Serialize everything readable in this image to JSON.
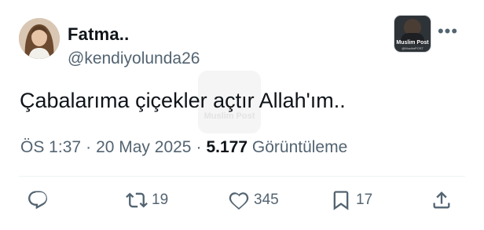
{
  "author": {
    "display_name": "Fatma..",
    "handle": "@kendiyolunda26"
  },
  "tweet": {
    "text": "Çabalarıma çiçekler açtır Allah'ım..",
    "time": "ÖS 1:37",
    "date": "20 May 2025",
    "separator": "·",
    "views_count": "5.177",
    "views_label": "Görüntüleme"
  },
  "brand_badge": {
    "title": "Muslim Post",
    "subtitle": "@MuslimPOST"
  },
  "watermark": {
    "text": "Muslim Post"
  },
  "more_label": "•••",
  "actions": {
    "reply_icon": "reply-icon",
    "retweet_icon": "retweet-icon",
    "retweet_count": "19",
    "like_icon": "heart-icon",
    "like_count": "345",
    "bookmark_icon": "bookmark-icon",
    "bookmark_count": "17",
    "share_icon": "share-icon"
  },
  "colors": {
    "text_primary": "#0f1419",
    "text_secondary": "#536471",
    "divider": "#eff3f4"
  }
}
